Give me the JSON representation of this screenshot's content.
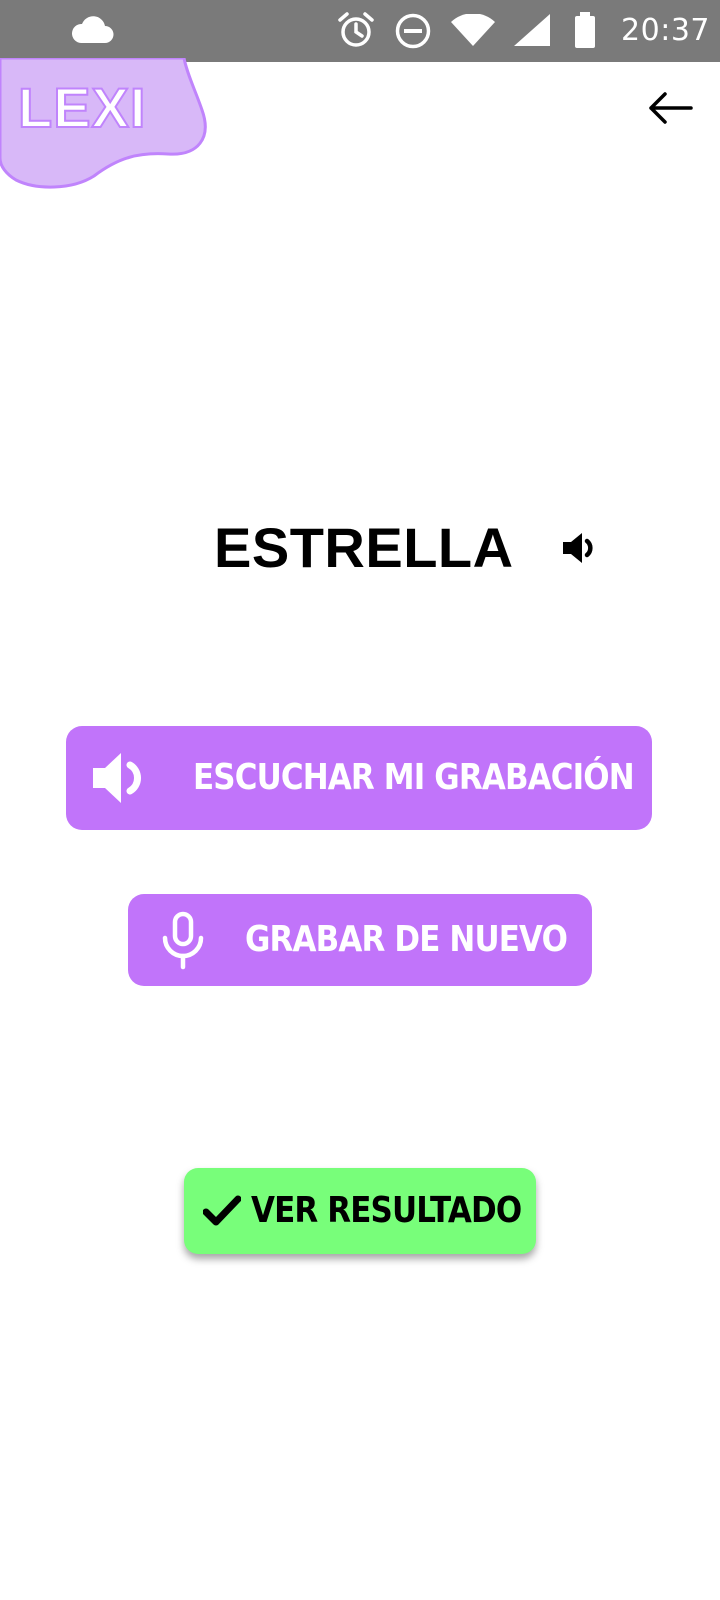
{
  "status_bar": {
    "time": "20:37",
    "icons": [
      "cloud-icon",
      "alarm-icon",
      "do-not-disturb-icon",
      "wifi-icon",
      "signal-icon",
      "battery-icon"
    ]
  },
  "header": {
    "logo_text": "LEXI",
    "back_icon": "arrow-left-icon"
  },
  "word": {
    "text": "ESTRELLA",
    "audio_icon": "speaker-icon"
  },
  "actions": {
    "listen_label": "ESCUCHAR MI GRABACIÓN",
    "listen_icon": "speaker-icon",
    "record_label": "GRABAR DE NUEVO",
    "record_icon": "microphone-icon",
    "result_label": "VER RESULTADO",
    "result_icon": "check-icon"
  },
  "colors": {
    "status_bar": "#7a7a7a",
    "accent_purple": "#c174fa",
    "logo_blob": "#d8b8f8",
    "result_green": "#78fe7a"
  }
}
